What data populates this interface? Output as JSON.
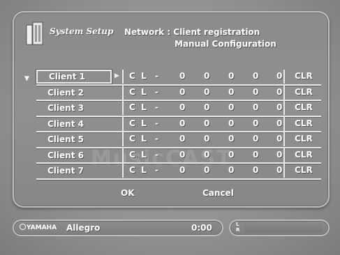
{
  "header": {
    "app_title": "System Setup",
    "title_line1": "Network : Client registration",
    "title_line2": "Manual Configuration",
    "icon": "network-plug-icon"
  },
  "clients": [
    {
      "name": "Client 1",
      "selected": true,
      "chars": [
        "C",
        "L",
        "-",
        "0",
        "0",
        "0",
        "0",
        "0"
      ],
      "clr": "CLR"
    },
    {
      "name": "Client 2",
      "selected": false,
      "chars": [
        "C",
        "L",
        "-",
        "0",
        "0",
        "0",
        "0",
        "0"
      ],
      "clr": "CLR"
    },
    {
      "name": "Client 3",
      "selected": false,
      "chars": [
        "C",
        "L",
        "-",
        "0",
        "0",
        "0",
        "0",
        "0"
      ],
      "clr": "CLR"
    },
    {
      "name": "Client 4",
      "selected": false,
      "chars": [
        "C",
        "L",
        "-",
        "0",
        "0",
        "0",
        "0",
        "0"
      ],
      "clr": "CLR"
    },
    {
      "name": "Client 5",
      "selected": false,
      "chars": [
        "C",
        "L",
        "-",
        "0",
        "0",
        "0",
        "0",
        "0"
      ],
      "clr": "CLR"
    },
    {
      "name": "Client 6",
      "selected": false,
      "chars": [
        "C",
        "L",
        "-",
        "0",
        "0",
        "0",
        "0",
        "0"
      ],
      "clr": "CLR"
    },
    {
      "name": "Client 7",
      "selected": false,
      "chars": [
        "C",
        "L",
        "-",
        "0",
        "0",
        "0",
        "0",
        "0"
      ],
      "clr": "CLR"
    }
  ],
  "buttons": {
    "ok": "OK",
    "cancel": "Cancel"
  },
  "status": {
    "brand": "YAMAHA",
    "track": "Allegro",
    "time": "0:00",
    "meter_left": "L",
    "meter_right": "R"
  },
  "colors": {
    "background": "#8f8f8f",
    "text": "#ffffff"
  }
}
